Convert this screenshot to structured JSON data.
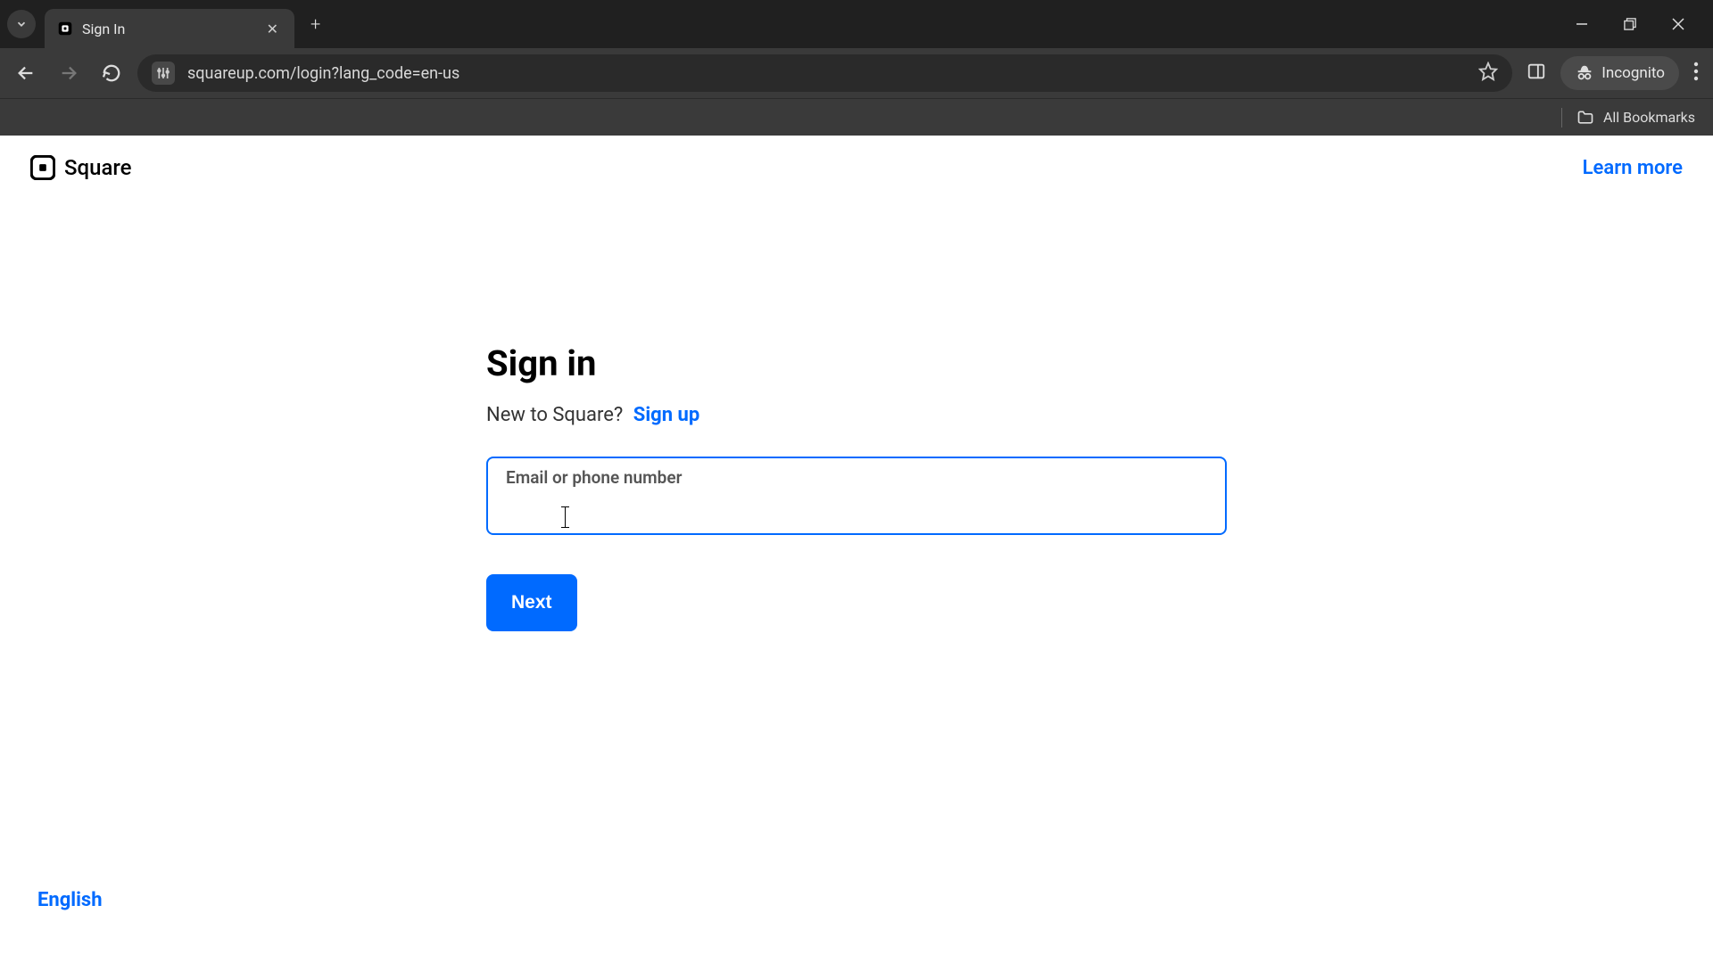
{
  "browser": {
    "tab_title": "Sign In",
    "url": "squareup.com/login?lang_code=en-us",
    "incognito_label": "Incognito",
    "all_bookmarks": "All Bookmarks"
  },
  "header": {
    "brand": "Square",
    "learn_more": "Learn more"
  },
  "signin": {
    "heading": "Sign in",
    "new_prompt": "New to Square?",
    "signup": "Sign up",
    "input_label": "Email or phone number",
    "input_value": "",
    "next": "Next"
  },
  "footer": {
    "language": "English"
  }
}
